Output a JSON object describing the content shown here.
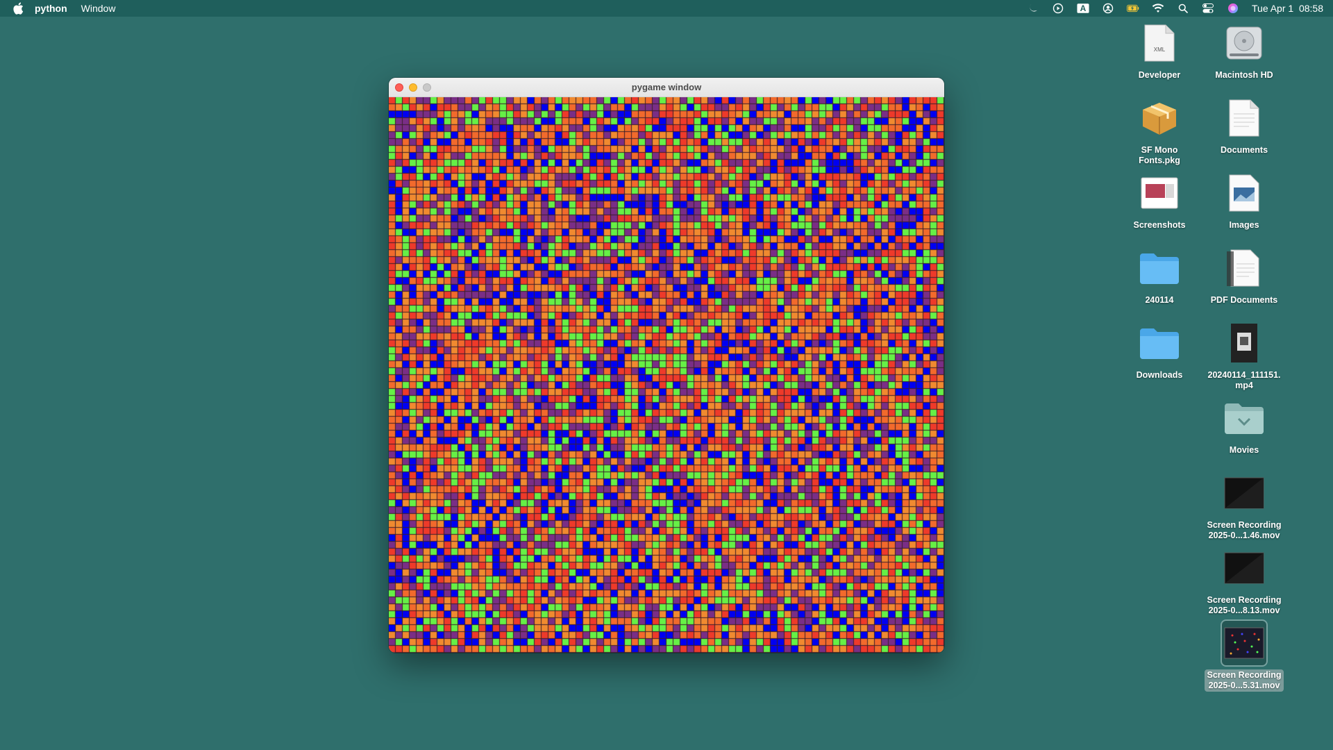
{
  "menubar": {
    "app_name": "python",
    "menus": [
      "Window"
    ],
    "status_icons": [
      "moon-icon",
      "play-circle-icon",
      "input-source-icon",
      "user-circle-icon",
      "battery-charging-icon",
      "wifi-icon",
      "search-icon",
      "control-center-icon",
      "siri-icon"
    ],
    "input_source_letter": "A",
    "clock": "Tue Apr 1  08:58"
  },
  "window": {
    "title": "pygame window",
    "grid": {
      "cells_per_side": 80,
      "palette": [
        "#0000f2",
        "#66f046",
        "#f26a2c",
        "#ee3a2a",
        "#7a2e86",
        "#f08a30"
      ],
      "gridline_color": "#3a1e2a"
    }
  },
  "desktop": {
    "icons": [
      {
        "label": "Developer",
        "icon": "xml-file-icon"
      },
      {
        "label": "Macintosh HD",
        "icon": "hard-drive-icon"
      },
      {
        "label": "SF Mono\nFonts.pkg",
        "icon": "package-icon"
      },
      {
        "label": "Documents",
        "icon": "document-icon"
      },
      {
        "label": "Screenshots",
        "icon": "screenshot-icon"
      },
      {
        "label": "Images",
        "icon": "image-file-icon"
      },
      {
        "label": "240114",
        "icon": "folder-icon"
      },
      {
        "label": "PDF Documents",
        "icon": "pdf-icon"
      },
      {
        "label": "Downloads",
        "icon": "folder-icon"
      },
      {
        "label": "20240114_111151.\nmp4",
        "icon": "video-thumbnail-icon"
      },
      {
        "label": "Movies",
        "icon": "movies-folder-icon"
      },
      {
        "label": "Screen Recording\n2025-0...1.46.mov",
        "icon": "recording-thumbnail-icon"
      },
      {
        "label": "Screen Recording\n2025-0...8.13.mov",
        "icon": "recording-thumbnail-icon"
      },
      {
        "label": "Screen Recording\n2025-0...5.31.mov",
        "icon": "recording-thumbnail-icon",
        "selected": true
      }
    ]
  }
}
